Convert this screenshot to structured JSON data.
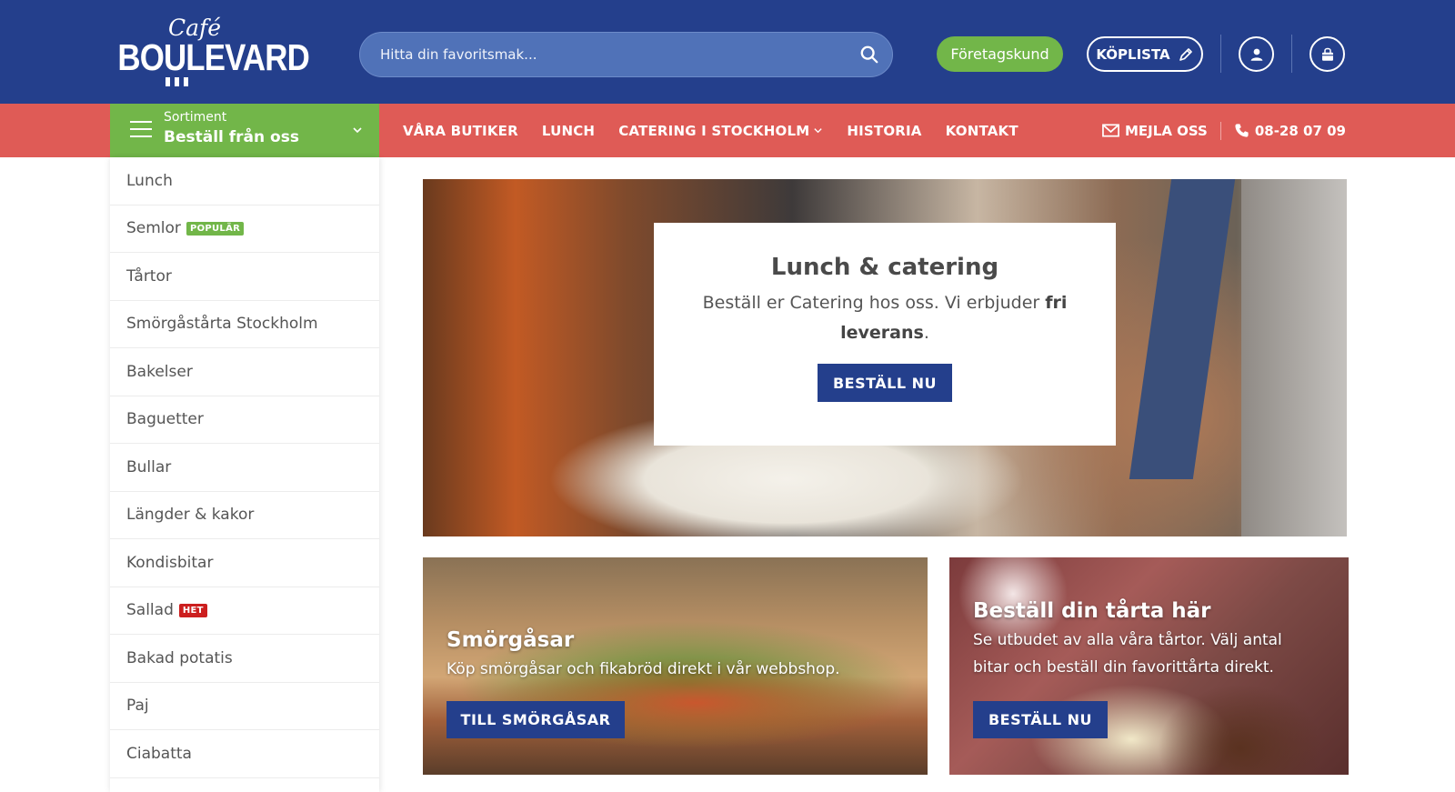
{
  "brand": {
    "logo_script": "Café",
    "logo_main": "BOULEVARD"
  },
  "header": {
    "search_placeholder": "Hitta din favoritsmak...",
    "company_button": "Företagskund",
    "shopping_list_button": "KÖPLISTA"
  },
  "sortiment": {
    "small_label": "Sortiment",
    "big_label": "Beställ från oss"
  },
  "nav": {
    "links": [
      "VÅRA BUTIKER",
      "LUNCH",
      "CATERING I STOCKHOLM",
      "HISTORIA",
      "KONTAKT"
    ],
    "email_label": "MEJLA OSS",
    "phone": "08-28 07 09"
  },
  "sidebar": {
    "items": [
      {
        "label": "Lunch"
      },
      {
        "label": "Semlor",
        "badge": "POPULÄR"
      },
      {
        "label": "Tårtor"
      },
      {
        "label": "Smörgåstårta Stockholm"
      },
      {
        "label": "Bakelser"
      },
      {
        "label": "Baguetter"
      },
      {
        "label": "Bullar"
      },
      {
        "label": "Längder & kakor"
      },
      {
        "label": "Kondisbitar"
      },
      {
        "label": "Sallad",
        "badge": "HET"
      },
      {
        "label": "Bakad potatis"
      },
      {
        "label": "Paj"
      },
      {
        "label": "Ciabatta"
      }
    ]
  },
  "hero": {
    "title": "Lunch & catering",
    "text_before": "Beställ er Catering hos oss. Vi erbjuder ",
    "text_bold": "fri leverans",
    "text_after": ".",
    "button": "BESTÄLL NU"
  },
  "promos": [
    {
      "title": "Smörgåsar",
      "text": "Köp smörgåsar och fikabröd direkt i vår webbshop.",
      "button": "TILL SMÖRGÅSAR"
    },
    {
      "title": "Beställ din tårta här",
      "text": "Se utbudet av alla våra tårtor. Välj antal bitar och beställ din favorittårta direkt.",
      "button": "BESTÄLL NU"
    }
  ],
  "colors": {
    "header_blue": "#243f8c",
    "nav_red": "#df5b56",
    "accent_green": "#72b649",
    "badge_red": "#cc1f1f"
  }
}
